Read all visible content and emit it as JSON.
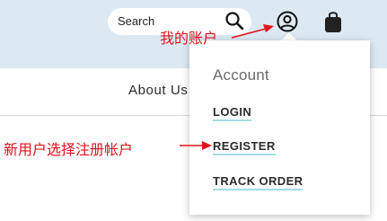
{
  "header": {
    "search": {
      "placeholder": "Search"
    },
    "icons": [
      "search-icon",
      "account-icon",
      "shopping-bag-icon"
    ]
  },
  "nav": {
    "about_label": "About Us"
  },
  "account_menu": {
    "title": "Account",
    "items": [
      {
        "label": "LOGIN"
      },
      {
        "label": "REGISTER"
      },
      {
        "label": "TRACK ORDER"
      }
    ]
  },
  "annotations": {
    "my_account": "我的账户",
    "register_hint": "新用户选择注册帐户"
  },
  "colors": {
    "header_bg": "#dce9f3",
    "annotation_red": "#e0141c",
    "link_underline": "#a7dce3"
  }
}
